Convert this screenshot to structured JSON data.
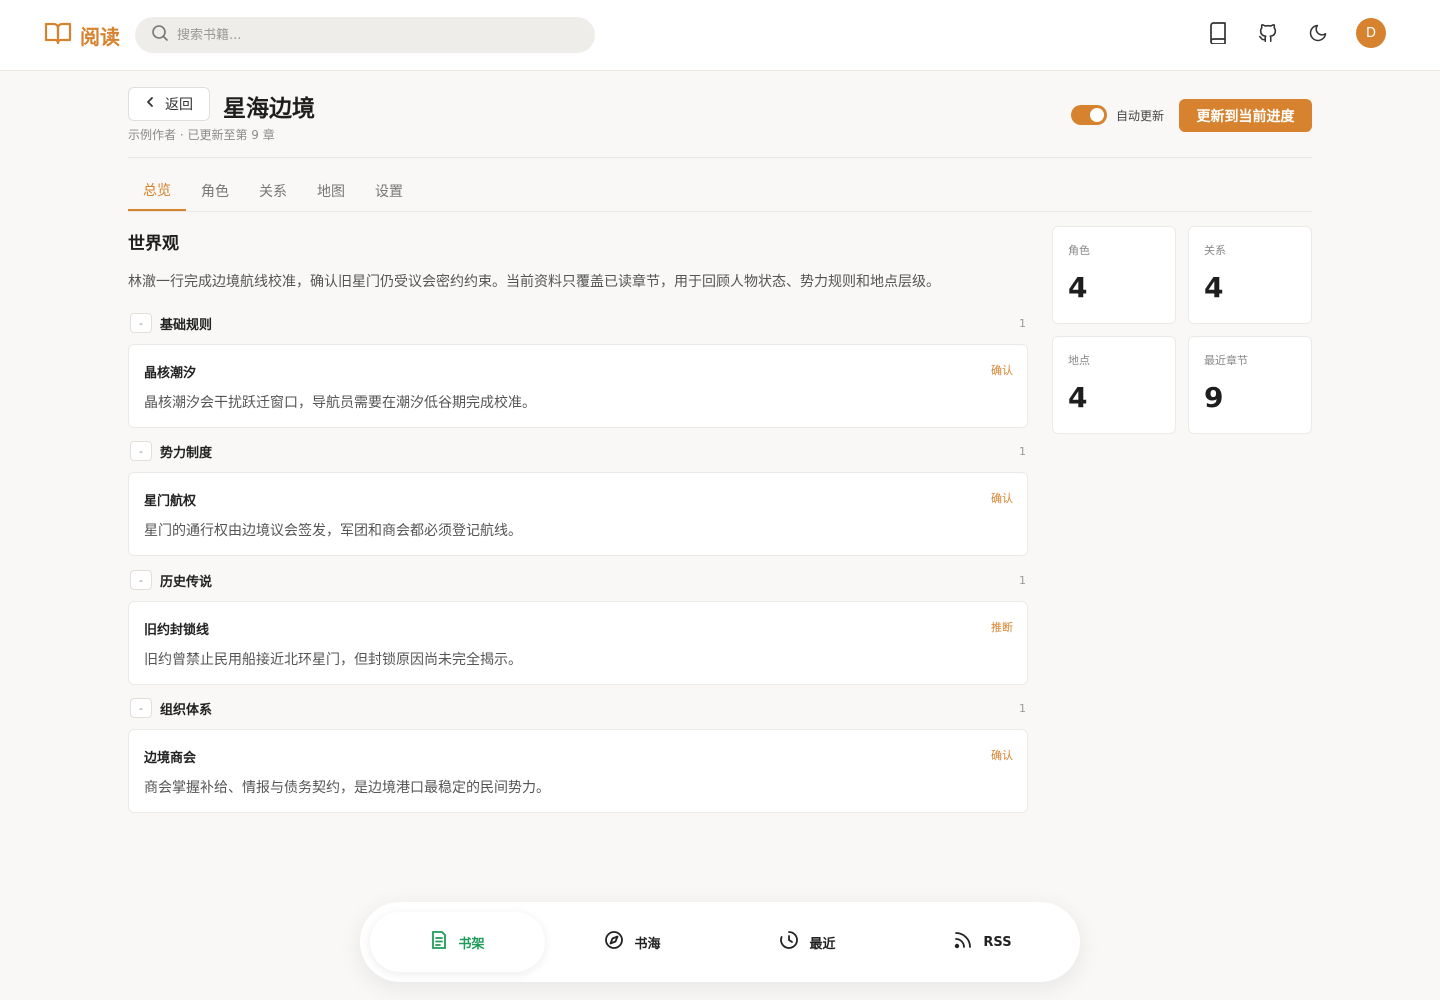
{
  "app": {
    "logo_text": "阅读"
  },
  "search": {
    "placeholder": "搜索书籍..."
  },
  "user": {
    "avatar_initial": "D"
  },
  "header": {
    "back_label": "返回",
    "title": "星海边境",
    "meta": "示例作者 · 已更新至第 9 章",
    "auto_update_label": "自动更新",
    "auto_update_on": true,
    "update_button": "更新到当前进度"
  },
  "tabs": [
    {
      "label": "总览",
      "active": true
    },
    {
      "label": "角色"
    },
    {
      "label": "关系"
    },
    {
      "label": "地图"
    },
    {
      "label": "设置"
    }
  ],
  "world": {
    "title": "世界观",
    "description": "林澈一行完成边境航线校准，确认旧星门仍受议会密约约束。当前资料只覆盖已读章节，用于回顾人物状态、势力规则和地点层级。",
    "groups": [
      {
        "name": "基础规则",
        "count": "1",
        "toggle": "-",
        "entry": {
          "name": "晶核潮汐",
          "tag": "确认",
          "desc": "晶核潮汐会干扰跃迁窗口，导航员需要在潮汐低谷期完成校准。"
        }
      },
      {
        "name": "势力制度",
        "count": "1",
        "toggle": "-",
        "entry": {
          "name": "星门航权",
          "tag": "确认",
          "desc": "星门的通行权由边境议会签发，军团和商会都必须登记航线。"
        }
      },
      {
        "name": "历史传说",
        "count": "1",
        "toggle": "-",
        "entry": {
          "name": "旧约封锁线",
          "tag": "推断",
          "desc": "旧约曾禁止民用船接近北环星门，但封锁原因尚未完全揭示。"
        }
      },
      {
        "name": "组织体系",
        "count": "1",
        "toggle": "-",
        "entry": {
          "name": "边境商会",
          "tag": "确认",
          "desc": "商会掌握补给、情报与债务契约，是边境港口最稳定的民间势力。"
        }
      }
    ]
  },
  "stats": [
    {
      "label": "角色",
      "value": "4"
    },
    {
      "label": "关系",
      "value": "4"
    },
    {
      "label": "地点",
      "value": "4"
    },
    {
      "label": "最近章节",
      "value": "9"
    }
  ],
  "bottom_nav": [
    {
      "label": "书架",
      "icon": "bookshelf-icon",
      "active": true
    },
    {
      "label": "书海",
      "icon": "compass-icon"
    },
    {
      "label": "最近",
      "icon": "history-icon"
    },
    {
      "label": "RSS",
      "icon": "rss-icon"
    }
  ],
  "colors": {
    "accent": "#d6822e",
    "active_nav": "#1f9c5a",
    "background": "#f9f8f6"
  }
}
